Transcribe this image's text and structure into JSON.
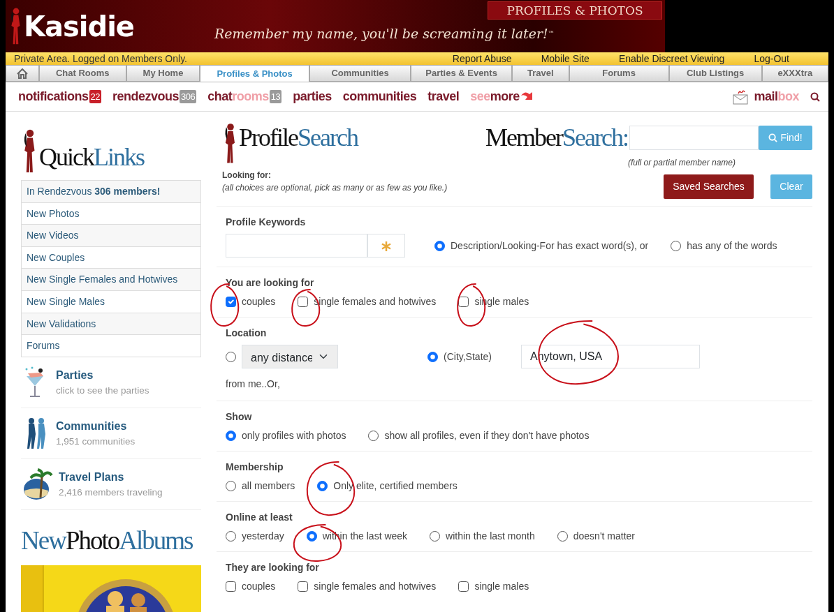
{
  "banner": {
    "logo": "Kasidie",
    "tagline": "Remember my name, you'll be screaming it later!",
    "trademark": "™",
    "section": "PROFILES & PHOTOS"
  },
  "top_bar": {
    "notice": "Private Area. Logged on Members Only.",
    "links": [
      "Report Abuse",
      "Mobile Site",
      "Enable Discreet Viewing",
      "Log-Out"
    ]
  },
  "tabs": [
    {
      "kind": "home",
      "selected": false
    },
    {
      "label": "Chat Rooms",
      "selected": false
    },
    {
      "label": "My Home",
      "selected": false
    },
    {
      "label": "Profiles & Photos",
      "selected": true
    },
    {
      "label": "Communities",
      "selected": false
    },
    {
      "label": "Parties & Events",
      "selected": false
    },
    {
      "label": "Travel",
      "selected": false
    },
    {
      "label": "Forums",
      "selected": false
    },
    {
      "label": "Club Listings",
      "selected": false
    },
    {
      "label": "eXXXtra",
      "selected": false
    }
  ],
  "quick_nav": [
    {
      "parts": [
        {
          "text": "notifications",
          "accent": false
        }
      ],
      "badge": "22",
      "color": "#c8202a"
    },
    {
      "parts": [
        {
          "text": "rendezvous",
          "accent": false
        }
      ],
      "badge": "306",
      "color": "#9a9a9a"
    },
    {
      "parts": [
        {
          "text": "chat",
          "accent": false
        },
        {
          "text": "rooms",
          "accent": true
        }
      ],
      "badge": "13",
      "color": "#9a9a9a"
    },
    {
      "parts": [
        {
          "text": "parties",
          "accent": false
        }
      ]
    },
    {
      "parts": [
        {
          "text": "communities",
          "accent": false
        }
      ]
    },
    {
      "parts": [
        {
          "text": "travel",
          "accent": false
        }
      ]
    },
    {
      "parts": [
        {
          "text": "see",
          "accent": true
        },
        {
          "text": "more",
          "accent": false
        }
      ],
      "kind": "more"
    }
  ],
  "mailbox": {
    "parts": [
      {
        "text": "mail",
        "accent": false
      },
      {
        "text": "box",
        "accent": true
      }
    ]
  },
  "sidebar": {
    "logo": [
      {
        "text": "Quick",
        "accent": false
      },
      {
        "text": "Links",
        "accent": true
      }
    ],
    "items": [
      {
        "text": "In Rendezvous **306 members!**"
      },
      {
        "text": "New Photos"
      },
      {
        "text": "New Videos"
      },
      {
        "text": "New Couples"
      },
      {
        "text": "New Single Females and Hotwives"
      },
      {
        "text": "New Single Males"
      },
      {
        "text": "New Validations"
      },
      {
        "text": "Forums"
      }
    ],
    "features": [
      {
        "kind": "party",
        "title": "Parties",
        "subtitle": "click to see the parties"
      },
      {
        "kind": "community",
        "title": "Communities",
        "subtitle": "1,951 communities"
      },
      {
        "kind": "travel",
        "title": "Travel Plans",
        "subtitle": "2,416 members traveling"
      }
    ],
    "albums_logo": [
      {
        "text": "New",
        "accent": true
      },
      {
        "text": "Photo",
        "accent": false
      },
      {
        "text": "Albums",
        "accent": true
      }
    ]
  },
  "search": {
    "profile_logo": [
      {
        "text": "Profile",
        "accent": false
      },
      {
        "text": "Search",
        "accent": true
      }
    ],
    "member_logo": [
      {
        "text": "Member",
        "accent": false
      },
      {
        "text": "Search:",
        "accent": true
      }
    ],
    "find_button": "Find!",
    "member_hint": "(full or partial member name)",
    "looking_for": "Looking for:",
    "looking_hint": "(all choices are optional, pick as many or as few as you like.)",
    "saved_button": "Saved Searches",
    "clear_button": "Clear",
    "sections": [
      {
        "title": "Profile Keywords",
        "fields": [
          {
            "kind": "keyword"
          },
          {
            "kind": "radio",
            "label": "Description/Looking-For has exact word(s), or",
            "selected": true
          },
          {
            "kind": "radio",
            "label": "has any of the words",
            "selected": false
          }
        ]
      },
      {
        "title": "You are looking for",
        "fields": [
          {
            "kind": "checkbox",
            "label": "couples",
            "checked": true
          },
          {
            "kind": "checkbox",
            "label": "single females and hotwives",
            "checked": false
          },
          {
            "kind": "checkbox",
            "label": "single males",
            "checked": false
          }
        ]
      },
      {
        "title": "Location",
        "fields": [
          {
            "kind": "radio",
            "selected": false
          },
          {
            "kind": "select",
            "value": "any distance"
          },
          {
            "kind": "radio",
            "label": "(City,State)",
            "selected": true
          },
          {
            "kind": "text",
            "value": "Anytown, USA"
          },
          {
            "kind": "note",
            "label": "from me..Or,"
          }
        ]
      },
      {
        "title": "Show",
        "fields": [
          {
            "kind": "radio",
            "label": "only profiles with photos",
            "selected": true
          },
          {
            "kind": "radio",
            "label": "show all profiles, even if they don't have photos",
            "selected": false
          }
        ]
      },
      {
        "title": "Membership",
        "fields": [
          {
            "kind": "radio",
            "label": "all members",
            "selected": false
          },
          {
            "kind": "radio",
            "label": "Only elite, certified members",
            "selected": true
          }
        ]
      },
      {
        "title": "Online at least",
        "fields": [
          {
            "kind": "radio",
            "label": "yesterday",
            "selected": false
          },
          {
            "kind": "radio",
            "label": "within the last week",
            "selected": true
          },
          {
            "kind": "radio",
            "label": "within the last month",
            "selected": false
          },
          {
            "kind": "radio",
            "label": "doesn't matter",
            "selected": false
          }
        ]
      },
      {
        "title": "They are looking for",
        "fields": [
          {
            "kind": "checkbox",
            "label": "couples",
            "checked": false
          },
          {
            "kind": "checkbox",
            "label": "single females and hotwives",
            "checked": false
          },
          {
            "kind": "checkbox",
            "label": "single males",
            "checked": false
          }
        ]
      }
    ]
  }
}
